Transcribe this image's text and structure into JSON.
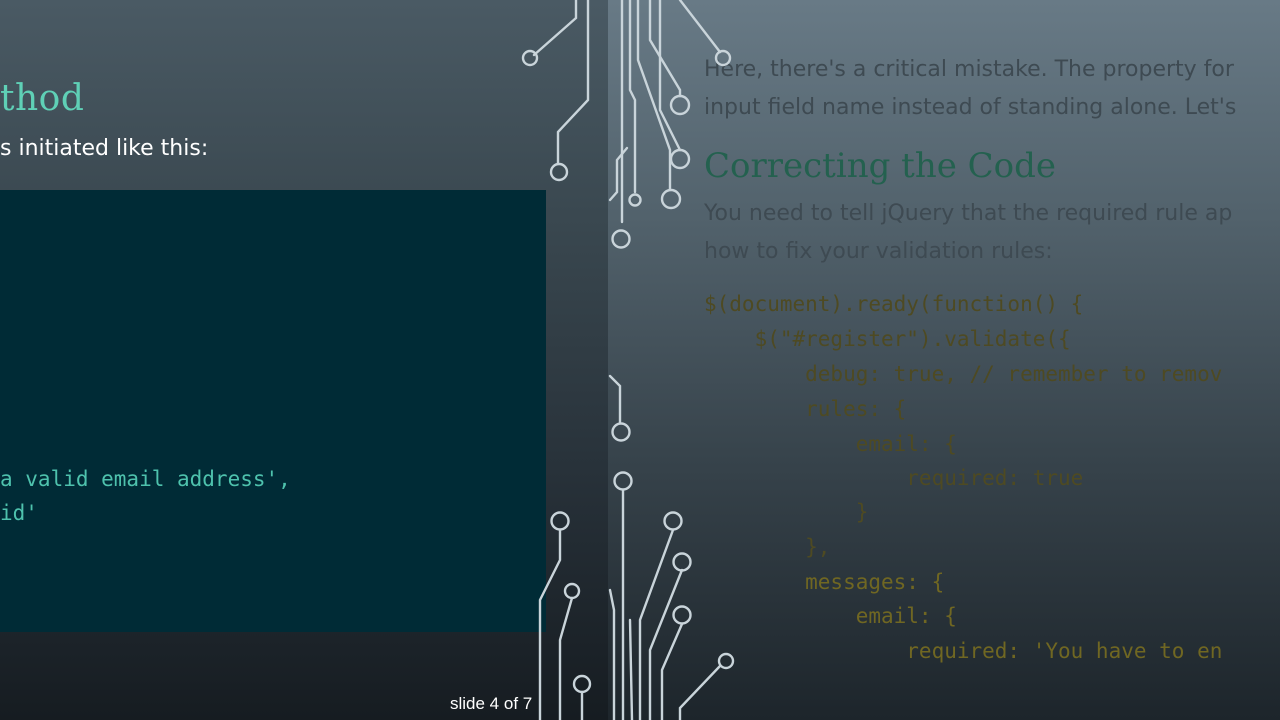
{
  "left_slide": {
    "heading": "thod",
    "intro": "s initiated like this:",
    "code_lines": [
      "a valid email address',",
      "id'"
    ]
  },
  "right_slide": {
    "paragraph1": [
      "Here, there's a critical mistake. The property for",
      "input field name instead of standing alone. Let's"
    ],
    "heading": "Correcting the Code",
    "paragraph2": [
      "You need to tell jQuery that the required rule ap",
      "how to fix your validation rules:"
    ],
    "code_lines": [
      "$(document).ready(function() {",
      "    $(\"#register\").validate({",
      "        debug: true, // remember to remov",
      "        rules: {",
      "            email: {",
      "                required: true",
      "            }",
      "        },",
      "        messages: {",
      "            email: {",
      "                required: 'You have to en"
    ]
  },
  "footer": {
    "slide_number": "slide 4 of 7"
  },
  "colors": {
    "heading_accent": "#5fd0b6",
    "code_background": "#002b36",
    "code_text": "#4ec2ad",
    "circuit_stroke": "#c9d4da"
  }
}
